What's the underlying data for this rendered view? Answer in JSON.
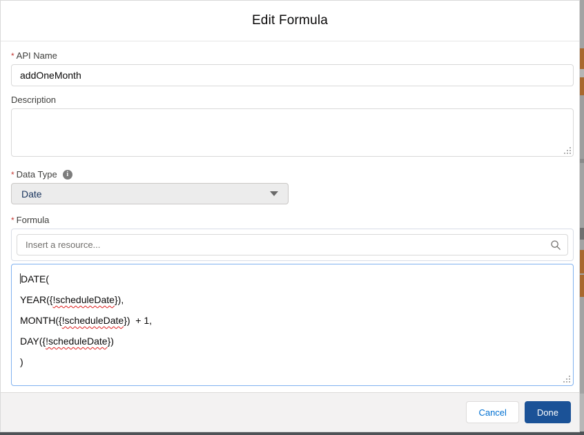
{
  "modal": {
    "title": "Edit Formula",
    "required_marker": "*"
  },
  "fields": {
    "api_name": {
      "label": "API Name",
      "required": true,
      "value": "addOneMonth"
    },
    "description": {
      "label": "Description",
      "value": ""
    },
    "data_type": {
      "label": "Data Type",
      "required": true,
      "selected_option": "Date"
    },
    "formula": {
      "label": "Formula",
      "required": true,
      "resource_picker_placeholder": "Insert a resource...",
      "lines": [
        [
          {
            "text": "DATE("
          }
        ],
        [
          {
            "text": "YEAR({"
          },
          {
            "text": "!scheduleDate",
            "misspelled": true
          },
          {
            "text": "}),"
          }
        ],
        [
          {
            "text": "MONTH({"
          },
          {
            "text": "!scheduleDate",
            "misspelled": true
          },
          {
            "text": "})  + 1,"
          }
        ],
        [
          {
            "text": "DAY({"
          },
          {
            "text": "!scheduleDate",
            "misspelled": true
          },
          {
            "text": "})"
          }
        ],
        [
          {
            "text": ")"
          }
        ]
      ]
    }
  },
  "icons": {
    "info_glyph": "i",
    "search": "magnifier",
    "dropdown": "chevron-down"
  },
  "footer": {
    "cancel_label": "Cancel",
    "done_label": "Done"
  },
  "colors": {
    "brand_button": "#1b5297",
    "link_text": "#0070d2",
    "required_asterisk": "#c23934",
    "spellcheck_underline": "#de1b1b",
    "focus_border": "#7fb1ef"
  }
}
